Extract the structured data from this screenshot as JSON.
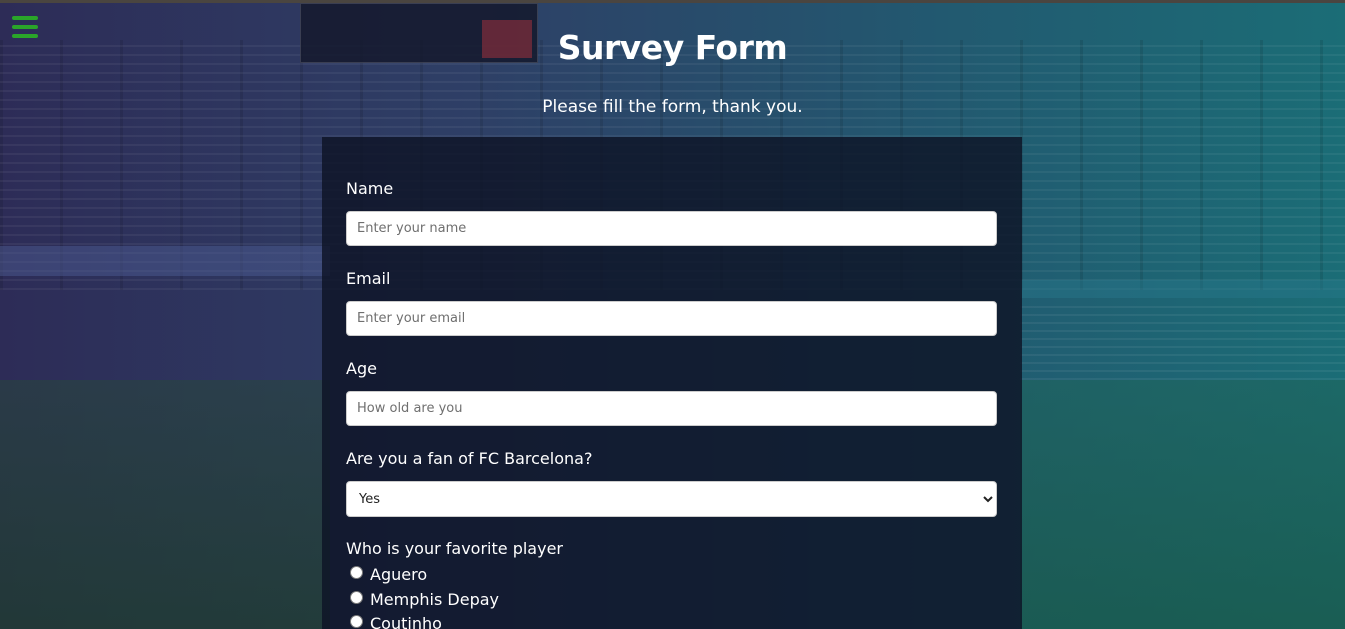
{
  "page": {
    "title": "Survey Form",
    "subtitle": "Please fill the form, thank you."
  },
  "menu": {
    "icon": "hamburger-menu-icon",
    "color": "#2aa52a"
  },
  "form": {
    "name": {
      "label": "Name",
      "placeholder": "Enter your name",
      "value": ""
    },
    "email": {
      "label": "Email",
      "placeholder": "Enter your email",
      "value": ""
    },
    "age": {
      "label": "Age",
      "placeholder": "How old are you",
      "value": ""
    },
    "fan": {
      "label": "Are you a fan of FC Barcelona?",
      "selected": "Yes"
    },
    "player": {
      "label": "Who is your favorite player",
      "options": [
        "Aguero",
        "Memphis Depay",
        "Coutinho"
      ]
    }
  },
  "colors": {
    "panel": "#0d1426",
    "text": "#ffffff",
    "input_bg": "#ffffff"
  }
}
